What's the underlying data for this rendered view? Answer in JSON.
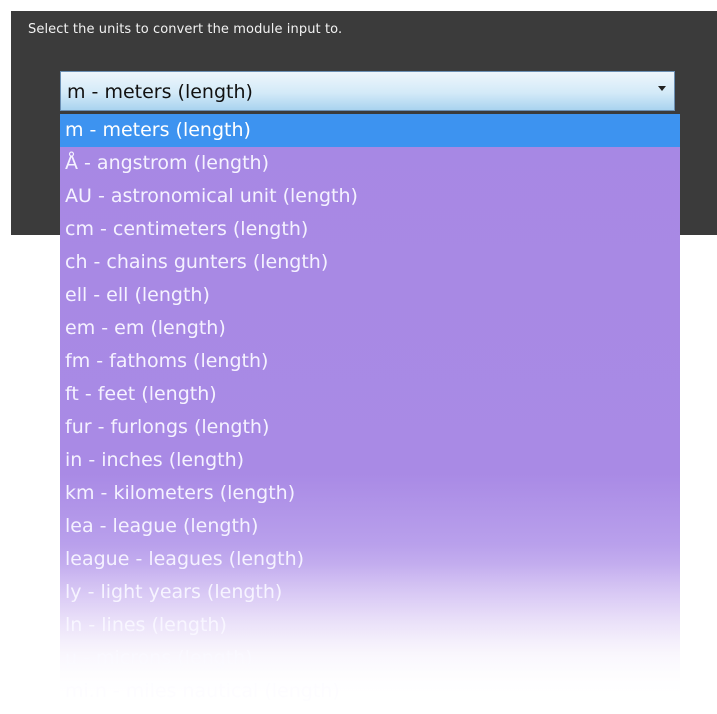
{
  "prompt": "Select the units to convert the module input to.",
  "select": {
    "value": "m - meters (length)",
    "options": [
      "m - meters (length)",
      "Å - angstrom (length)",
      "AU - astronomical unit (length)",
      "cm - centimeters (length)",
      "ch - chains gunters (length)",
      "ell - ell (length)",
      "em - em (length)",
      "fm - fathoms (length)",
      "ft - feet (length)",
      "fur - furlongs (length)",
      "in - inches (length)",
      "km - kilometers (length)",
      "lea - league (length)",
      "league - leagues (length)",
      "ly - light years (length)",
      "ln - lines (length)",
      "µ - microns (length)",
      "mi.n - miles nautical (length)"
    ],
    "selected_index": 0
  },
  "colors": {
    "panel": "#3b3b3b",
    "dropdown": "#a788e4",
    "highlight": "#3d93f0"
  },
  "icons": {
    "dropdown_arrow": "triangle-down-icon"
  }
}
